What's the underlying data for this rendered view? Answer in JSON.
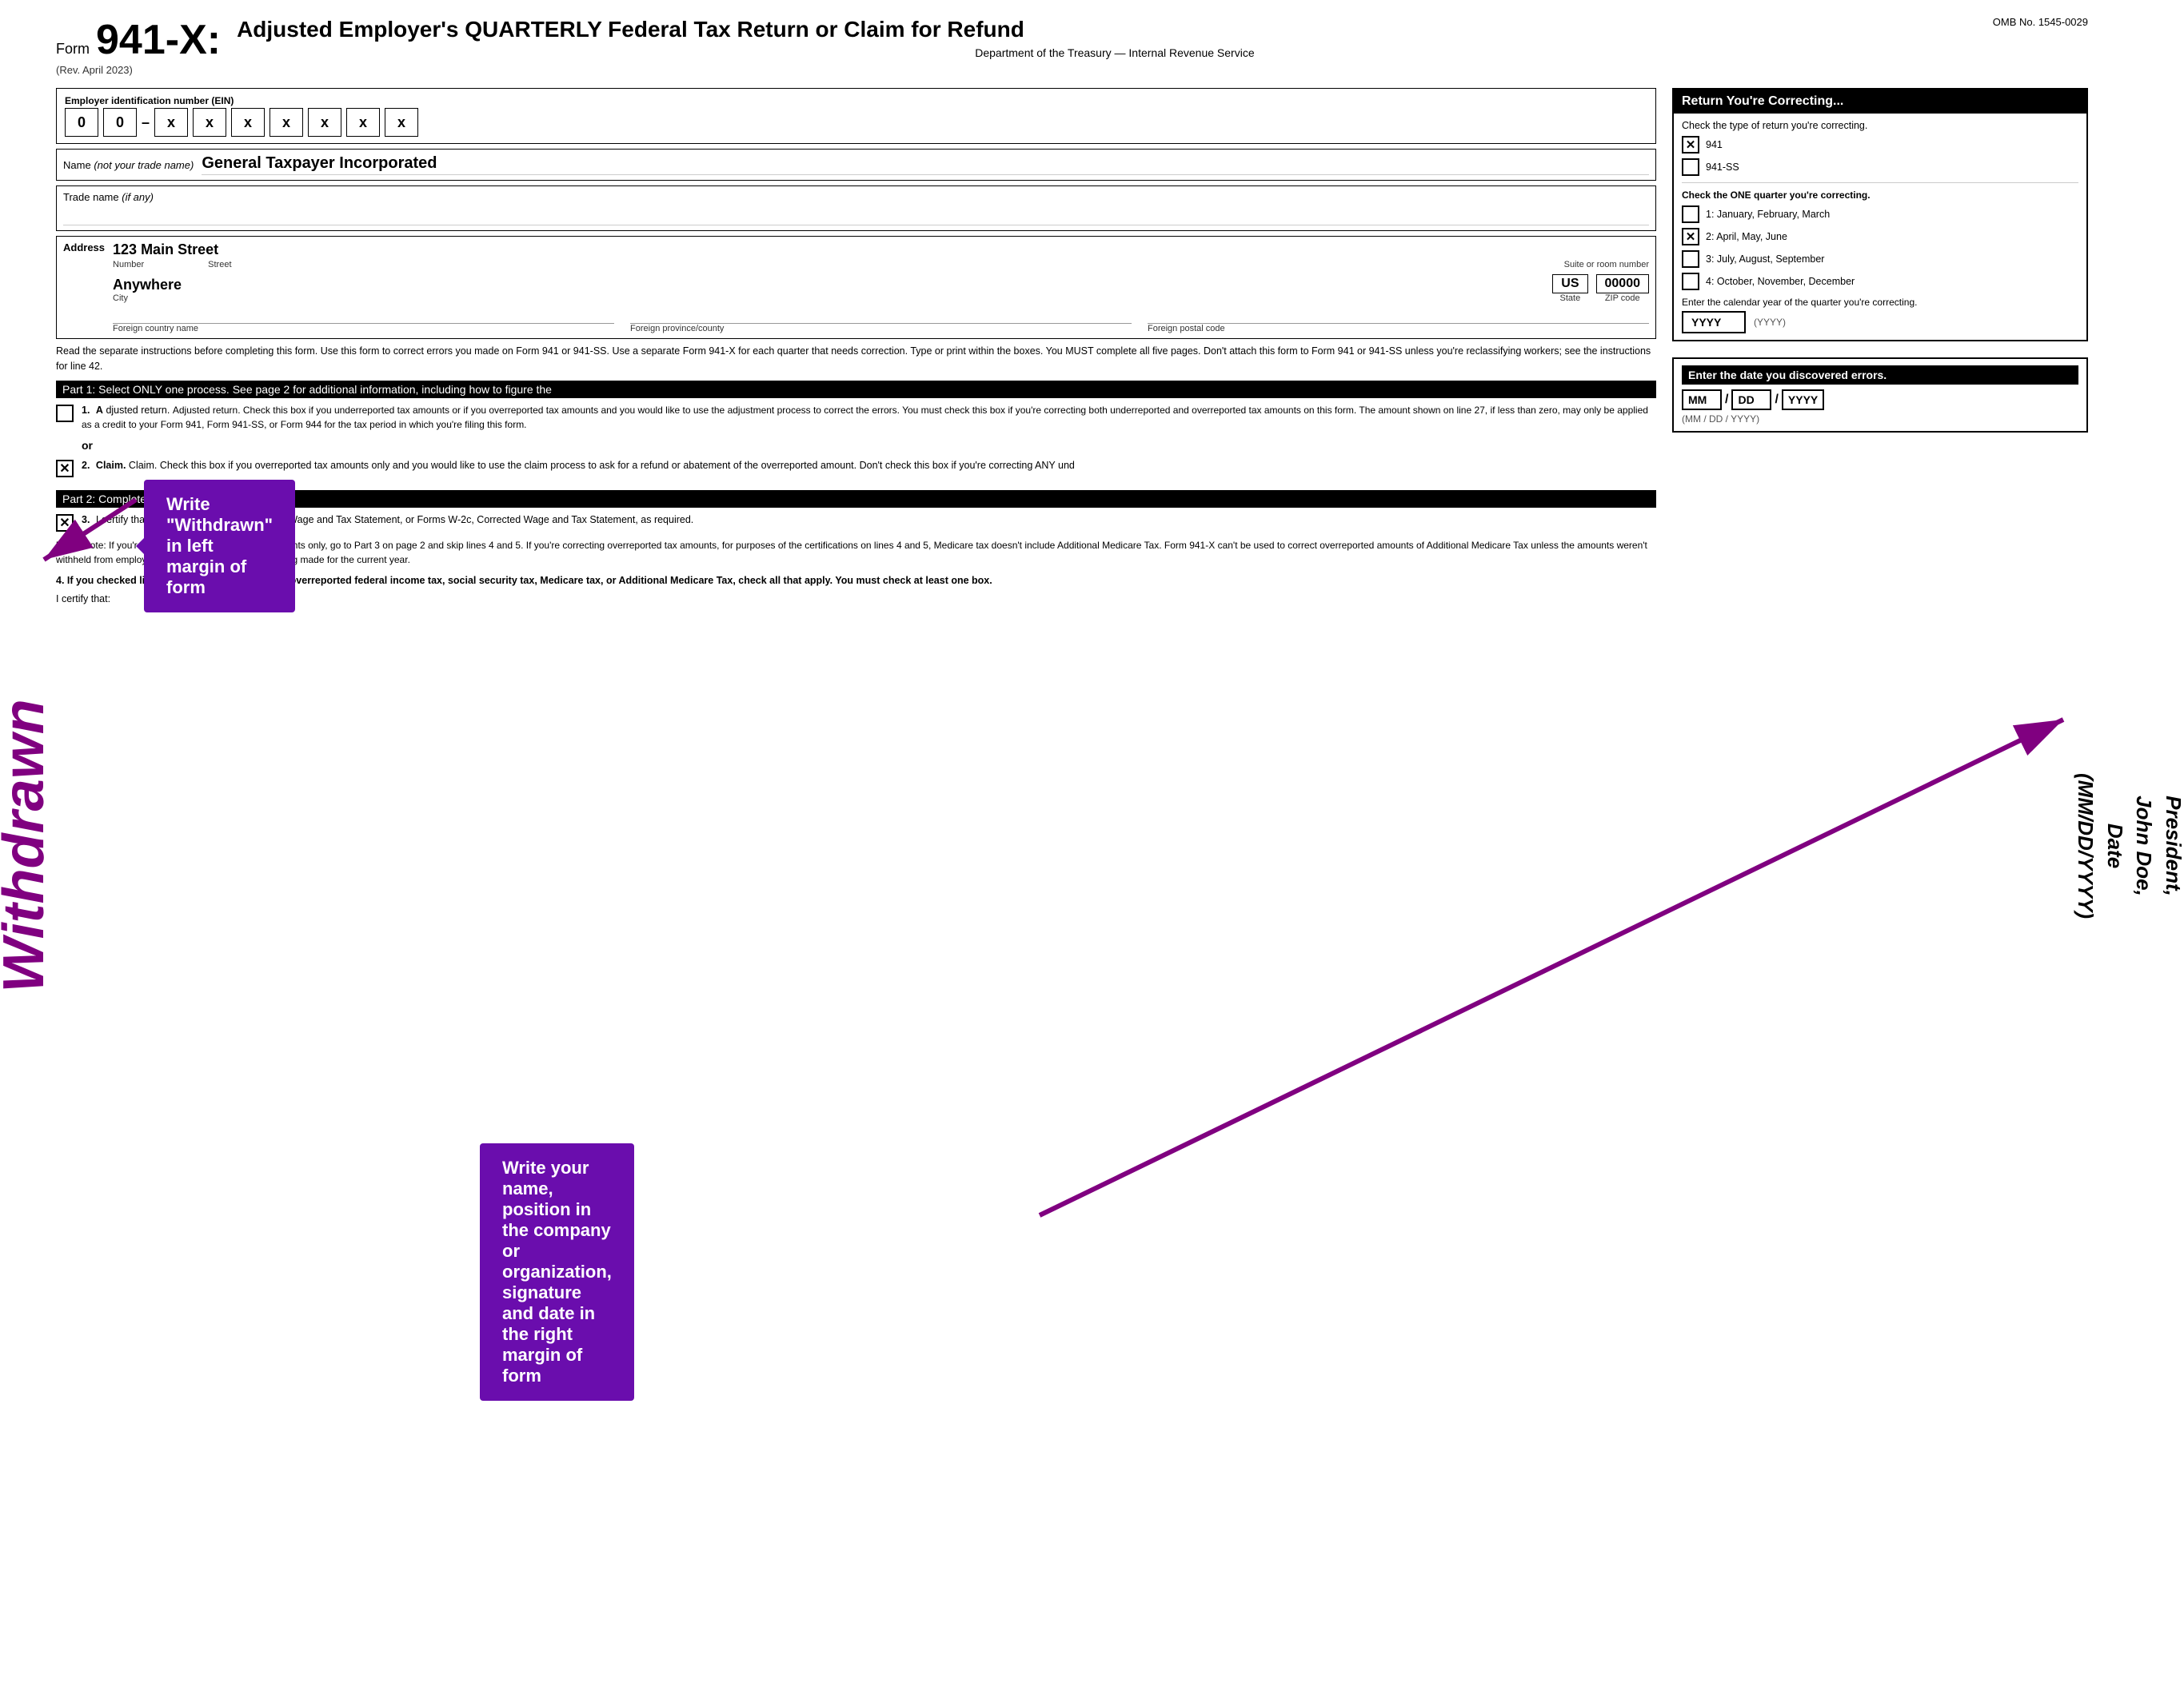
{
  "form": {
    "number": "941-X:",
    "form_label": "Form",
    "title": "Adjusted Employer's QUARTERLY Federal Tax Return or Claim for Refund",
    "rev": "(Rev. April 2023)",
    "dept": "Department of the Treasury — Internal Revenue Service",
    "omb": "OMB No. 1545-0029"
  },
  "employer": {
    "ein_label": "Employer identification number",
    "ein_sub": "(EIN)",
    "ein_digits": [
      "0",
      "0",
      "x",
      "x",
      "x",
      "x",
      "x",
      "x",
      "x"
    ],
    "name_label": "Name",
    "name_label_italic": "(not your trade name)",
    "name_value": "General Taxpayer Incorporated",
    "trade_label": "Trade name",
    "trade_label_italic": "(if any)",
    "address_label": "Address",
    "address_value": "123 Main Street",
    "address_sub1": "Number",
    "address_sub2": "Street",
    "address_sub3": "Suite or room number",
    "city_value": "Anywhere",
    "city_label": "City",
    "state_value": "US",
    "state_label": "State",
    "zip_value": "00000",
    "zip_label": "ZIP code",
    "foreign_country_label": "Foreign country name",
    "foreign_province_label": "Foreign province/county",
    "foreign_postal_label": "Foreign postal code"
  },
  "instructions": {
    "text": "Read the separate instructions before completing this form. Use this form to correct errors you made on Form 941 or 941-SS. Use a separate Form 941-X for each quarter that needs correction. Type or print within the boxes. You MUST complete all five pages. Don't attach this form to Form 941 or 941-SS unless you're reclassifying workers; see the instructions for line 42."
  },
  "part1": {
    "label": "Part 1:",
    "description": "Select ONLY one process. See page 2 for additional information, including how to figure the",
    "item1_label": "1.",
    "item1_text": "Adjusted return. Check this box if you underreported tax amounts or if you overreported tax amounts and you would like to use the adjustment process to correct the errors. You must check this box if you're correcting both underreported and overreported tax amounts on this form. The amount shown on line 27, if less than zero, may only be applied as a credit to your Form 941, Form 941-SS, or Form 944 for the tax period in which you're filing this form.",
    "item2_label": "2.",
    "item2_text": "Claim. Check this box if you overreported tax amounts only and you would like to use the claim process to ask for a refund or abatement of the overreported amount. Don't check this box if you're correcting ANY und",
    "item2_checked": true
  },
  "part2": {
    "label": "Part 2:",
    "description": "Complete the certifications.",
    "item3_label": "3.",
    "item3_text": "I certify that I've filed or will file Forms W-2, Wage and Tax Statement, or Forms W-2c, Corrected Wage and Tax Statement, as required.",
    "item3_checked": true,
    "note_text": "Note: If you're correcting underreported tax amounts only, go to Part 3 on page 2 and skip lines 4 and 5. If you're correcting overreported tax amounts, for purposes of the certifications on lines 4 and 5, Medicare tax doesn't include Additional Medicare Tax. Form 941-X can't be used to correct overreported amounts of Additional Medicare Tax unless the amounts weren't withheld from employee wages or an adjustment is being made for the current year.",
    "item4_text": "4. If you checked line 1 because you're adjusting overreported federal income tax, social security tax, Medicare tax, or Additional Medicare Tax, check all that apply. You must check at least one box.",
    "item4_sub": "I certify that:"
  },
  "return_box": {
    "header": "Return You're Correcting...",
    "check_label": "Check the type of return you're correcting.",
    "option_941": "941",
    "option_941_checked": true,
    "option_941ss": "941-SS",
    "option_941ss_checked": false,
    "quarter_label": "Check the ONE quarter you're correcting.",
    "q1": "1: January, February, March",
    "q1_checked": false,
    "q2": "2: April, May, June",
    "q2_checked": true,
    "q3": "3: July, August, September",
    "q3_checked": false,
    "q4": "4: October, November, December",
    "q4_checked": false,
    "calendar_label": "Enter the calendar year of the quarter you're correcting.",
    "yyyy_label": "YYYY",
    "yyyy_hint": "(YYYY)"
  },
  "error_date": {
    "header": "Enter the date you discovered errors.",
    "mm_label": "MM",
    "dd_label": "DD",
    "yyyy_label": "YYYY",
    "hint": "(MM / DD / YYYY)"
  },
  "tooltips": {
    "withdrawn": "Write \"Withdrawn\" in left margin of form",
    "right_margin": "Write your name, position in the company or organization, signature and date in the right margin of form"
  },
  "right_margin": {
    "text": "John Doe, President, John Doe, Date (MM/DD/YYYY)"
  },
  "withdrawn_margin": {
    "text": "Withdrawn"
  }
}
